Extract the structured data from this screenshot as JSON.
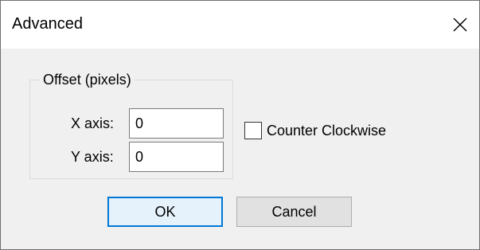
{
  "window": {
    "title": "Advanced",
    "close_icon": "close-icon"
  },
  "offset_group": {
    "legend": "Offset (pixels)",
    "x_axis": {
      "label": "X axis:",
      "value": "0"
    },
    "y_axis": {
      "label": "Y axis:",
      "value": "0"
    }
  },
  "counter_clockwise": {
    "label": "Counter Clockwise",
    "checked": false
  },
  "buttons": {
    "ok": "OK",
    "cancel": "Cancel"
  },
  "colors": {
    "focus_border": "#0078d7",
    "dialog_bg": "#f0f0f0"
  }
}
